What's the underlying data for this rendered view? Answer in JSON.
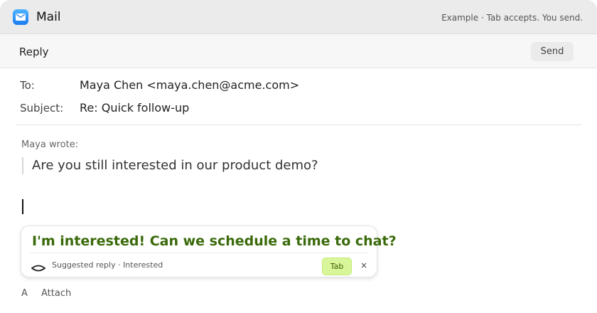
{
  "window": {
    "app_title": "Mail",
    "app_icon": "mail-envelope-icon",
    "note": "Example · Tab accepts. You send."
  },
  "toolbar": {
    "title": "Reply",
    "send_label": "Send"
  },
  "fields": {
    "to_label": "To:",
    "to_value": "Maya Chen <maya.chen@acme.com>",
    "subject_label": "Subject:",
    "subject_value": "Re: Quick follow-up"
  },
  "quote": {
    "author": "Maya wrote:",
    "text": "Are you still interested in our product demo?"
  },
  "suggestion": {
    "text": "I'm interested! Can we schedule a time to chat?",
    "meta": "Suggested reply · Interested",
    "icon": "eye-icon",
    "tab_label": "Tab",
    "dismiss_label": "×"
  },
  "bottom": {
    "format_label": "A",
    "attach_label": "Attach"
  },
  "colors": {
    "suggestion_text": "#3a6a0a",
    "tab_background": "#d9f79a",
    "titlebar_background": "#ebebeb"
  }
}
